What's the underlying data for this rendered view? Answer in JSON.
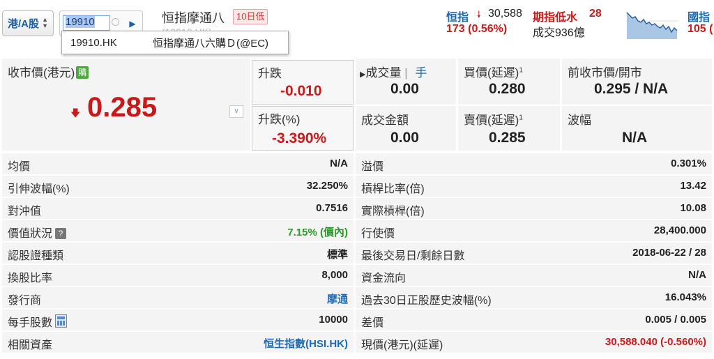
{
  "toolbar": {
    "market_select": "港/A股",
    "search_value": "19910",
    "stock_name": "恒指摩通八",
    "low_badge": "10日低",
    "code_ghost": "(19910.HK)",
    "suggestion": {
      "code": "19910.HK",
      "name": "恒指摩通八六購Ｄ(@EC)"
    }
  },
  "indices": {
    "hsi_label": "恒指",
    "hsi_value": "30,588",
    "hsi_change": "173 (0.56%)",
    "futures_label": "期指低水",
    "futures_value": "28",
    "turnover": "成交936億",
    "guozhi_label": "國指",
    "guozhi_change": "105 (",
    "colors": {
      "up": "#cc1a1a",
      "down": "#cc1a1a",
      "link": "#1a6ab8"
    }
  },
  "quote": {
    "close_label": "收市價(港元)",
    "buy_badge": "購",
    "close_value": "0.285",
    "change_label": "升跌",
    "change_value": "-0.010",
    "change_pct_label": "升跌(%)",
    "change_pct_value": "-3.390%",
    "volume_label": "成交量",
    "volume_unit": "手",
    "volume_value": "0.00",
    "turnover_label": "成交金額",
    "turnover_value": "0.00",
    "bid_label": "買價(延遲)",
    "bid_value": "0.280",
    "ask_label": "賣價(延遲)",
    "ask_value": "0.285",
    "prev_open_label": "前收市價/開市",
    "prev_open_value": "0.295 / N/A",
    "range_label": "波幅",
    "range_value": "N/A",
    "superscript": "1"
  },
  "details_left": [
    {
      "k": "均價",
      "v": "N/A"
    },
    {
      "k": "引伸波幅(%)",
      "v": "32.250%"
    },
    {
      "k": "對沖值",
      "v": "0.7516"
    },
    {
      "k": "價值狀況",
      "v": "7.15% (價內)"
    },
    {
      "k": "認股證種類",
      "v": "標準"
    },
    {
      "k": "換股比率",
      "v": "8,000"
    },
    {
      "k": "發行商",
      "v": "摩通"
    },
    {
      "k": "每手股數",
      "v": "10000"
    },
    {
      "k": "相關資產",
      "v": "恒生指數(HSI.HK)"
    }
  ],
  "details_right": [
    {
      "k": "溢價",
      "v": "0.301%"
    },
    {
      "k": "槓桿比率(倍)",
      "v": "13.42"
    },
    {
      "k": "實際槓桿(倍)",
      "v": "10.08"
    },
    {
      "k": "行使價",
      "v": "28,400.000"
    },
    {
      "k": "最後交易日/剩餘日數",
      "v": "2018-06-22 / 28"
    },
    {
      "k": "資金流向",
      "v": "N/A"
    },
    {
      "k": "過去30日正股歷史波幅(%)",
      "v": "16.043%"
    },
    {
      "k": "差價",
      "v": "0.005 / 0.005"
    },
    {
      "k": "現價(港元)(延遲)",
      "v": "30,588.040 (-0.560%)"
    }
  ]
}
